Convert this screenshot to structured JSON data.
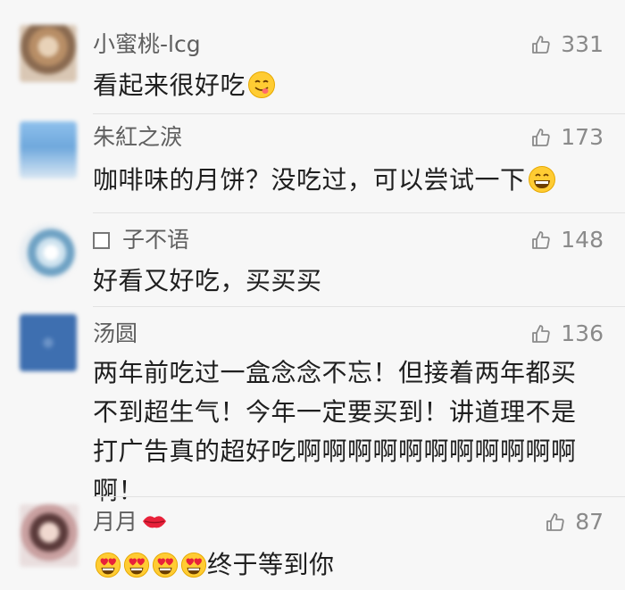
{
  "comments": [
    {
      "username": "小蜜桃-lcg",
      "likes": "331",
      "text": "看起来很好吃",
      "trailing_emoji": "yum-face-icon",
      "avatar_color": "#c9a37a"
    },
    {
      "username": "朱紅之淚",
      "likes": "173",
      "text": "咖啡味的月饼？没吃过，可以尝试一下",
      "trailing_emoji": "grinning-face-icon",
      "avatar_color": "#74a6d6"
    },
    {
      "username": "子不语",
      "likes": "148",
      "text": "好看又好吃，买买买",
      "avatar_color": "#6fa2c4"
    },
    {
      "username": "汤圆",
      "likes": "136",
      "text_lines": [
        "两年前吃过一盒念念不忘！但接着两年都买",
        "不到超生气！今年一定要买到！讲道理不是",
        "打广告真的超好吃啊啊啊啊啊啊啊啊啊啊啊",
        "啊！"
      ],
      "avatar_color": "#3e6fb0"
    },
    {
      "username": "月月",
      "username_emoji": "kiss-mark-icon",
      "likes": "87",
      "text": "终于等到你",
      "leading_emoji": [
        "heart-eyes-icon",
        "heart-eyes-icon",
        "heart-eyes-icon",
        "heart-eyes-icon"
      ],
      "avatar_color": "#b58c8c"
    }
  ],
  "colors": {
    "background": "#f7f7f7",
    "username": "#5f5f5f",
    "body_text": "#1f1f1f",
    "like_count": "#8a8a8a"
  }
}
